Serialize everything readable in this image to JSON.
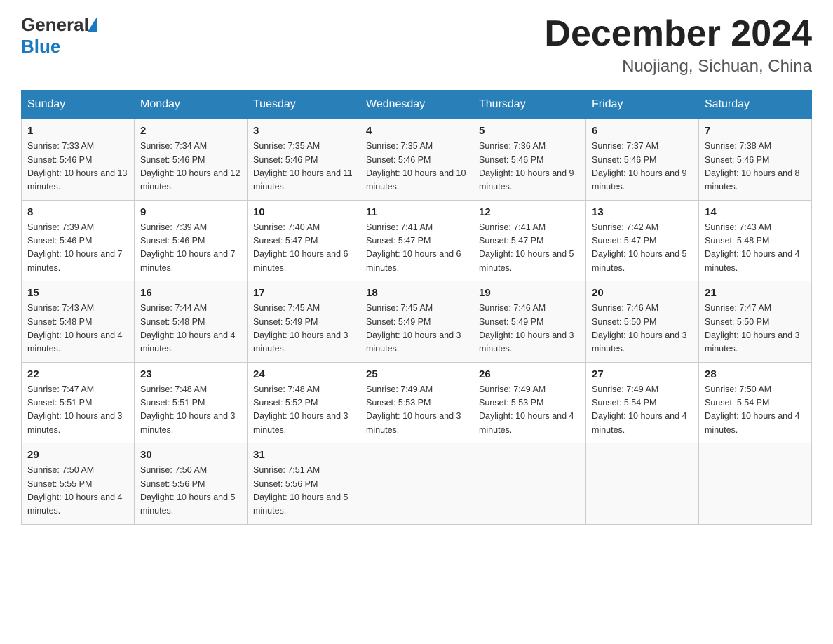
{
  "header": {
    "logo_general": "General",
    "logo_blue": "Blue",
    "month_title": "December 2024",
    "location": "Nuojiang, Sichuan, China"
  },
  "weekdays": [
    "Sunday",
    "Monday",
    "Tuesday",
    "Wednesday",
    "Thursday",
    "Friday",
    "Saturday"
  ],
  "weeks": [
    [
      {
        "day": "1",
        "sunrise": "7:33 AM",
        "sunset": "5:46 PM",
        "daylight": "10 hours and 13 minutes."
      },
      {
        "day": "2",
        "sunrise": "7:34 AM",
        "sunset": "5:46 PM",
        "daylight": "10 hours and 12 minutes."
      },
      {
        "day": "3",
        "sunrise": "7:35 AM",
        "sunset": "5:46 PM",
        "daylight": "10 hours and 11 minutes."
      },
      {
        "day": "4",
        "sunrise": "7:35 AM",
        "sunset": "5:46 PM",
        "daylight": "10 hours and 10 minutes."
      },
      {
        "day": "5",
        "sunrise": "7:36 AM",
        "sunset": "5:46 PM",
        "daylight": "10 hours and 9 minutes."
      },
      {
        "day": "6",
        "sunrise": "7:37 AM",
        "sunset": "5:46 PM",
        "daylight": "10 hours and 9 minutes."
      },
      {
        "day": "7",
        "sunrise": "7:38 AM",
        "sunset": "5:46 PM",
        "daylight": "10 hours and 8 minutes."
      }
    ],
    [
      {
        "day": "8",
        "sunrise": "7:39 AM",
        "sunset": "5:46 PM",
        "daylight": "10 hours and 7 minutes."
      },
      {
        "day": "9",
        "sunrise": "7:39 AM",
        "sunset": "5:46 PM",
        "daylight": "10 hours and 7 minutes."
      },
      {
        "day": "10",
        "sunrise": "7:40 AM",
        "sunset": "5:47 PM",
        "daylight": "10 hours and 6 minutes."
      },
      {
        "day": "11",
        "sunrise": "7:41 AM",
        "sunset": "5:47 PM",
        "daylight": "10 hours and 6 minutes."
      },
      {
        "day": "12",
        "sunrise": "7:41 AM",
        "sunset": "5:47 PM",
        "daylight": "10 hours and 5 minutes."
      },
      {
        "day": "13",
        "sunrise": "7:42 AM",
        "sunset": "5:47 PM",
        "daylight": "10 hours and 5 minutes."
      },
      {
        "day": "14",
        "sunrise": "7:43 AM",
        "sunset": "5:48 PM",
        "daylight": "10 hours and 4 minutes."
      }
    ],
    [
      {
        "day": "15",
        "sunrise": "7:43 AM",
        "sunset": "5:48 PM",
        "daylight": "10 hours and 4 minutes."
      },
      {
        "day": "16",
        "sunrise": "7:44 AM",
        "sunset": "5:48 PM",
        "daylight": "10 hours and 4 minutes."
      },
      {
        "day": "17",
        "sunrise": "7:45 AM",
        "sunset": "5:49 PM",
        "daylight": "10 hours and 3 minutes."
      },
      {
        "day": "18",
        "sunrise": "7:45 AM",
        "sunset": "5:49 PM",
        "daylight": "10 hours and 3 minutes."
      },
      {
        "day": "19",
        "sunrise": "7:46 AM",
        "sunset": "5:49 PM",
        "daylight": "10 hours and 3 minutes."
      },
      {
        "day": "20",
        "sunrise": "7:46 AM",
        "sunset": "5:50 PM",
        "daylight": "10 hours and 3 minutes."
      },
      {
        "day": "21",
        "sunrise": "7:47 AM",
        "sunset": "5:50 PM",
        "daylight": "10 hours and 3 minutes."
      }
    ],
    [
      {
        "day": "22",
        "sunrise": "7:47 AM",
        "sunset": "5:51 PM",
        "daylight": "10 hours and 3 minutes."
      },
      {
        "day": "23",
        "sunrise": "7:48 AM",
        "sunset": "5:51 PM",
        "daylight": "10 hours and 3 minutes."
      },
      {
        "day": "24",
        "sunrise": "7:48 AM",
        "sunset": "5:52 PM",
        "daylight": "10 hours and 3 minutes."
      },
      {
        "day": "25",
        "sunrise": "7:49 AM",
        "sunset": "5:53 PM",
        "daylight": "10 hours and 3 minutes."
      },
      {
        "day": "26",
        "sunrise": "7:49 AM",
        "sunset": "5:53 PM",
        "daylight": "10 hours and 4 minutes."
      },
      {
        "day": "27",
        "sunrise": "7:49 AM",
        "sunset": "5:54 PM",
        "daylight": "10 hours and 4 minutes."
      },
      {
        "day": "28",
        "sunrise": "7:50 AM",
        "sunset": "5:54 PM",
        "daylight": "10 hours and 4 minutes."
      }
    ],
    [
      {
        "day": "29",
        "sunrise": "7:50 AM",
        "sunset": "5:55 PM",
        "daylight": "10 hours and 4 minutes."
      },
      {
        "day": "30",
        "sunrise": "7:50 AM",
        "sunset": "5:56 PM",
        "daylight": "10 hours and 5 minutes."
      },
      {
        "day": "31",
        "sunrise": "7:51 AM",
        "sunset": "5:56 PM",
        "daylight": "10 hours and 5 minutes."
      },
      null,
      null,
      null,
      null
    ]
  ]
}
